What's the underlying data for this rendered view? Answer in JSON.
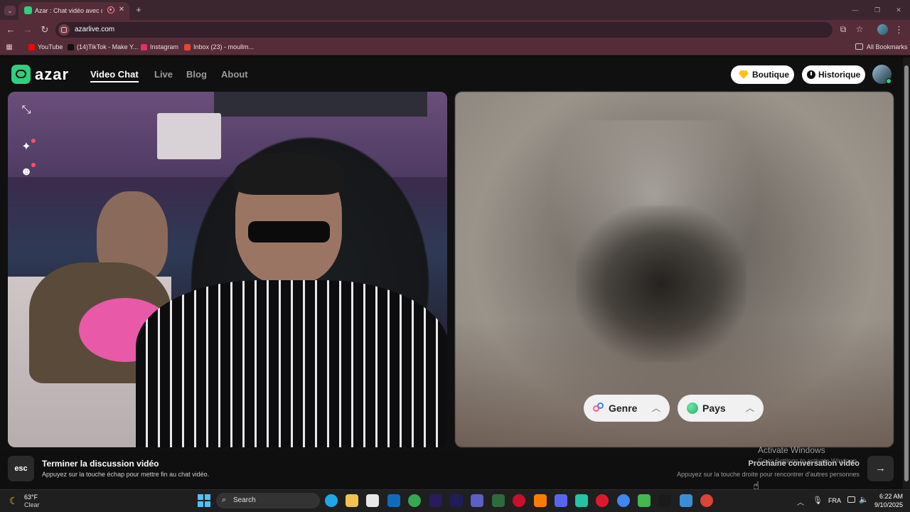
{
  "browser": {
    "tab_title": "Azar : Chat vidéo avec de n",
    "url": "azarlive.com",
    "controls": {
      "minimize": "—",
      "maximize": "❐",
      "close": "✕"
    },
    "bookmarks": [
      {
        "label": "YouTube",
        "icon": "youtube-icon",
        "color": "#ff0000"
      },
      {
        "label": "(14)TikTok - Make Y...",
        "icon": "tiktok-icon",
        "color": "#111111"
      },
      {
        "label": "Instagram",
        "icon": "instagram-icon",
        "color": "#e1306c"
      },
      {
        "label": "Inbox (23) - moullm...",
        "icon": "gmail-icon",
        "color": "#ea4335"
      }
    ],
    "all_bookmarks": "All Bookmarks"
  },
  "site": {
    "logo": "azar",
    "nav": [
      "Video Chat",
      "Live",
      "Blog",
      "About"
    ],
    "boutique": "Boutique",
    "historique": "Historique",
    "filters": {
      "genre": "Genre",
      "pays": "Pays"
    },
    "end": {
      "key": "esc",
      "title": "Terminer la discussion vidéo",
      "subtitle": "Appuyez sur la touche échap pour mettre fin au chat vidéo."
    },
    "next": {
      "title": "Prochaine conversation vidéo",
      "subtitle": "Appuyez sur la touche droite pour rencontrer d'autres personnes"
    },
    "accent": "#2bd17e"
  },
  "overlay": {
    "activate": "Activate Windows",
    "goto": "Go to Settings to activate Windows."
  },
  "taskbar": {
    "temp": "63°F",
    "weather": "Clear",
    "search": "Search",
    "lang": "FRA",
    "time": "6:22 AM",
    "date": "9/10/2025"
  }
}
